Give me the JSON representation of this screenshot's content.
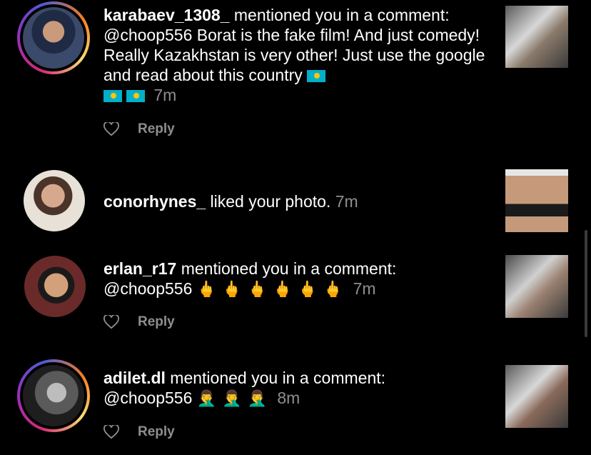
{
  "notifications": [
    {
      "username": "karabaev_1308_",
      "action": " mentioned you in a comment:",
      "mention": "@choop556",
      "body": " Borat is the fake film! And just comedy! Really Kazakhstan is very other! Just use the google and read about this country ",
      "time": "7m",
      "reply_label": "Reply",
      "emoji_type": "kazakhstan-flag",
      "emoji_count": 3
    },
    {
      "username": "conorhynes_",
      "action": " liked your photo.",
      "time": "7m"
    },
    {
      "username": "erlan_r17",
      "action": " mentioned you in a comment:",
      "mention": "@choop556",
      "emoji_type": "middle-finger",
      "emoji_glyph": "🖕",
      "emoji_count": 6,
      "time": "7m",
      "reply_label": "Reply"
    },
    {
      "username": "adilet.dl",
      "action": " mentioned you in a comment:",
      "mention": "@choop556",
      "emoji_type": "man-facepalming",
      "emoji_glyph": "🤦‍♂️",
      "emoji_count": 3,
      "time": "8m",
      "reply_label": "Reply"
    }
  ],
  "colors": {
    "background": "#000000",
    "text": "#ffffff",
    "secondary": "#8e8e8e"
  }
}
